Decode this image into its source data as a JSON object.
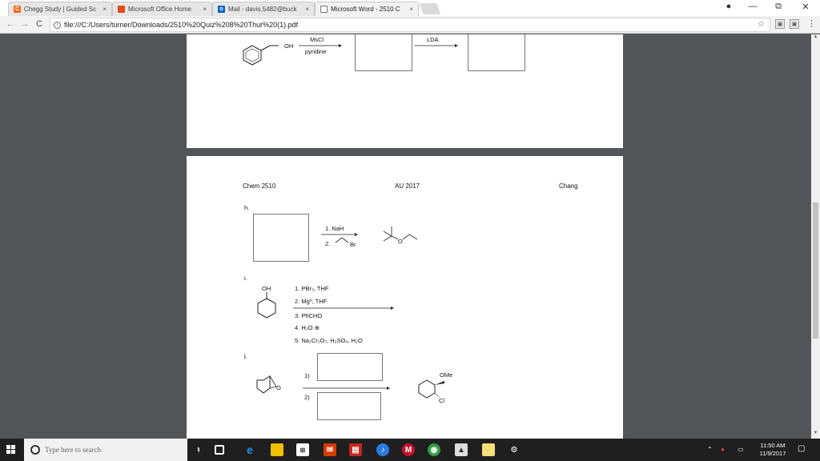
{
  "browser": {
    "tabs": [
      {
        "title": "Chegg Study | Guided Sc",
        "close": "×",
        "favicon_letter": "C",
        "favicon_color": "#f06a1d",
        "active": false
      },
      {
        "title": "Microsoft Office Home",
        "close": "×",
        "favicon_letter": "",
        "favicon_color": "#e64a19",
        "active": false
      },
      {
        "title": "Mail - davis.5482@buck",
        "close": "×",
        "favicon_letter": "o",
        "favicon_color": "#0a64c8",
        "active": false
      },
      {
        "title": "Microsoft Word - 2510 C",
        "close": "×",
        "favicon_letter": "",
        "favicon_color": "#ffffff",
        "active": true
      }
    ],
    "url": "file:///C:/Users/turner/Downloads/2510%20Quiz%208%20Thur%20(1).pdf",
    "window_controls": {
      "account": "●",
      "minimize": "—",
      "maximize": "⧉",
      "close": "✕"
    },
    "nav": {
      "back": "←",
      "forward": "→",
      "reload": "C"
    }
  },
  "page1": {
    "reagent_top": "MsCl",
    "reagent_bottom": "pyridine",
    "oh_label": "OH",
    "lda_label": "LDA"
  },
  "page2": {
    "header_left": "Chem 2510",
    "header_center": "AU 2017",
    "header_right": "Chang",
    "problem_h": {
      "label": "h.",
      "step1": "1. NaH",
      "step2": "2.",
      "br_label": "Br",
      "o_label": "O"
    },
    "problem_i": {
      "label": "i.",
      "oh_label": "OH",
      "steps": [
        "1. PBr₃, THF",
        "2. Mg⁰, THF",
        "3. PhCHO",
        "4. H₃O ⊕",
        "5. Na₂Cr₂O₇, H₂SO₄, H₂O"
      ]
    },
    "problem_j": {
      "label": "j.",
      "step1": "1)",
      "step2": "2)",
      "o_label": "O",
      "ome_label": "OMe",
      "cl_label": "Cl"
    }
  },
  "taskbar": {
    "search_placeholder": "Type here to search",
    "time": "11:50 AM",
    "date": "11/9/2017"
  }
}
